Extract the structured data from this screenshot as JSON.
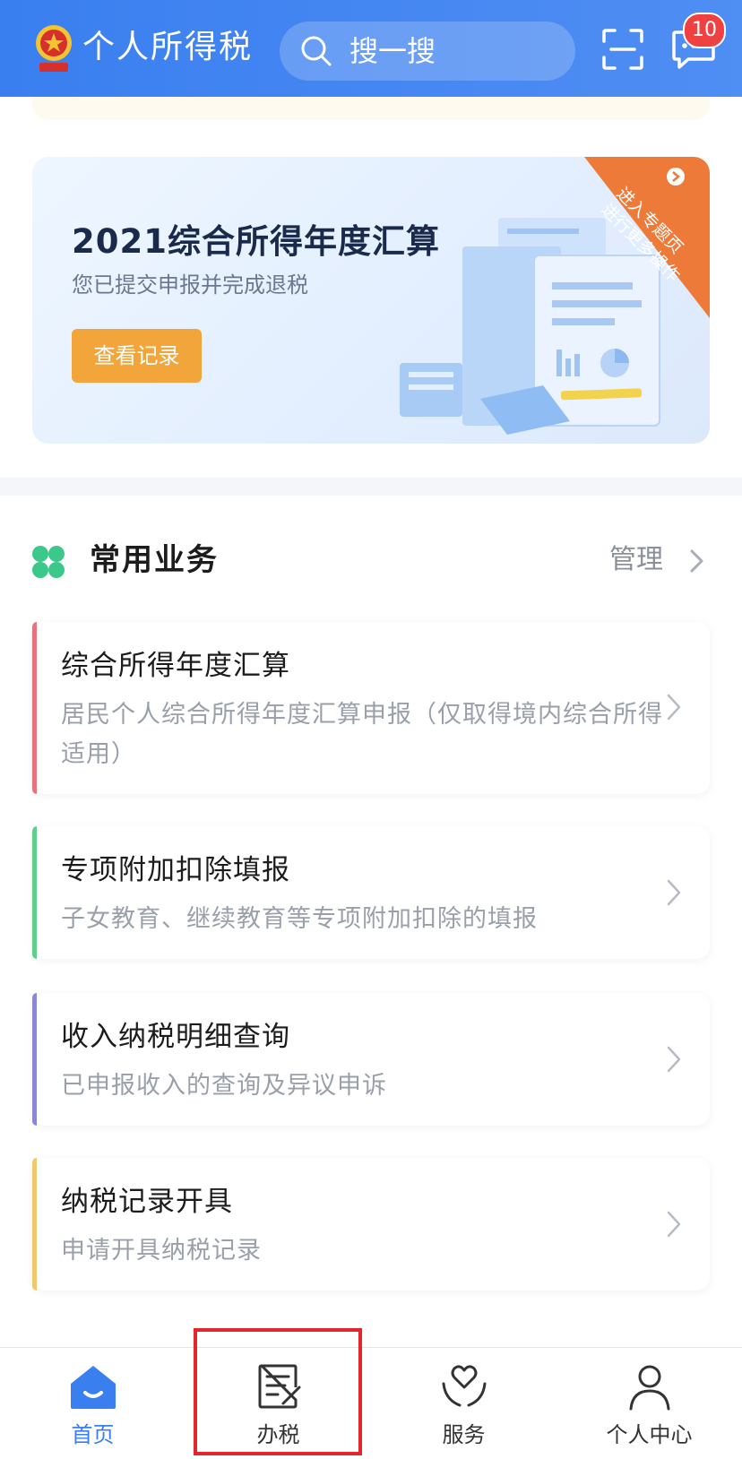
{
  "header": {
    "app_title": "个人所得税",
    "search_placeholder": "搜一搜",
    "message_badge": "10"
  },
  "banner": {
    "title": "2021综合所得年度汇算",
    "subtitle": "您已提交申报并完成退税",
    "button_label": "查看记录",
    "ribbon_line1": "进入专题页",
    "ribbon_line2": "进行更多操作"
  },
  "common_services": {
    "title": "常用业务",
    "manage_label": "管理",
    "items": [
      {
        "title": "综合所得年度汇算",
        "desc": "居民个人综合所得年度汇算申报（仅取得境内综合所得适用）",
        "accent": "#e8737c"
      },
      {
        "title": "专项附加扣除填报",
        "desc": "子女教育、继续教育等专项附加扣除的填报",
        "accent": "#5fcf8c"
      },
      {
        "title": "收入纳税明细查询",
        "desc": "已申报收入的查询及异议申诉",
        "accent": "#8c86d8"
      },
      {
        "title": "纳税记录开具",
        "desc": "申请开具纳税记录",
        "accent": "#f1c86a"
      }
    ]
  },
  "tabbar": {
    "tabs": [
      {
        "label": "首页",
        "icon": "home-icon",
        "active": true
      },
      {
        "label": "办税",
        "icon": "document-edit-icon",
        "active": false
      },
      {
        "label": "服务",
        "icon": "heart-hands-icon",
        "active": false
      },
      {
        "label": "个人中心",
        "icon": "user-icon",
        "active": false
      }
    ]
  },
  "colors": {
    "header_blue": "#3a7ff0",
    "banner_button": "#f2a53a",
    "ribbon": "#ee7a3a",
    "badge_red": "#ef4141",
    "highlight_red": "#e2262c"
  }
}
